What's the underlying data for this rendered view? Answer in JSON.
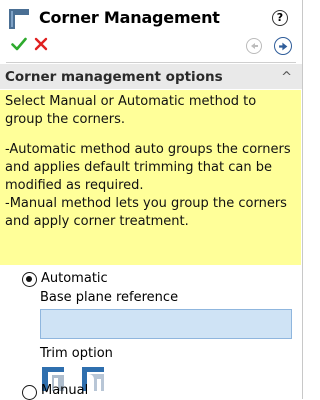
{
  "header": {
    "title": "Corner Management",
    "icons": [
      "corner-management-icon",
      "help-icon",
      "ok-check-icon",
      "cancel-x-icon",
      "back-arrow-icon",
      "forward-arrow-icon"
    ]
  },
  "section": {
    "title": "Corner management options",
    "note": [
      "Select Manual or Automatic method to group the corners.",
      "-Automatic method auto groups the corners and applies default trimming that can be modified as required.",
      "-Manual method lets you group the corners and apply corner treatment."
    ]
  },
  "options": {
    "automatic_label": "Automatic",
    "automatic_selected": true,
    "base_plane_label": "Base plane reference",
    "base_plane_value": "",
    "trim_label": "Trim option",
    "manual_label": "Manual",
    "manual_selected": false
  },
  "colors": {
    "note_bg": "#ffff99",
    "section_bg": "#e9e9e9",
    "input_bg": "#cfe3f5",
    "ok_green": "#2eaa2e",
    "cancel_red": "#e02020",
    "accent_blue": "#2f5d9a"
  }
}
